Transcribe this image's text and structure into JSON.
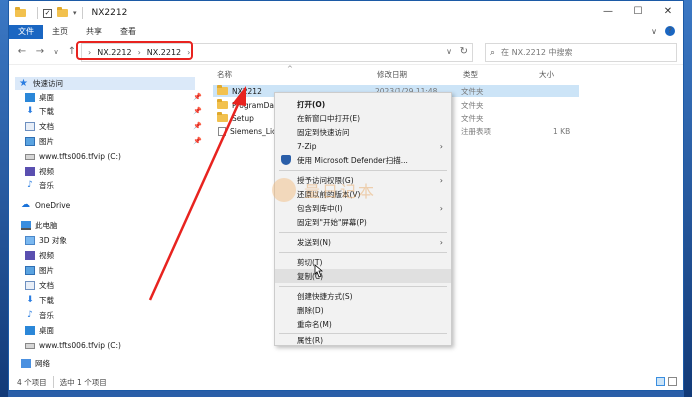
{
  "window": {
    "title": "NX2212",
    "quick_access_check": "✓",
    "controls": {
      "minimize": "—",
      "maximize": "☐",
      "close": "✕"
    }
  },
  "ribbon": {
    "tabs": [
      "文件",
      "主页",
      "共享",
      "查看"
    ],
    "expand": "∨",
    "help": "?"
  },
  "nav": {
    "back": "←",
    "forward": "→",
    "recent": "∨",
    "up": "↑",
    "address_crumbs": [
      "NX.2212",
      "NX.2212"
    ],
    "address_prefix": "›",
    "address_dropdown": "∨",
    "refresh": "↻",
    "search_placeholder": "在 NX.2212 中搜索",
    "search_icon": "search-icon",
    "highlight_color": "#e8231f"
  },
  "sidebar": {
    "pin": "📌",
    "quick_access": "快速访问",
    "quick_items": [
      {
        "label": "桌面",
        "icon": "desktop-icon",
        "pinned": true
      },
      {
        "label": "下载",
        "icon": "download-icon",
        "pinned": true
      },
      {
        "label": "文档",
        "icon": "document-icon",
        "pinned": true
      },
      {
        "label": "图片",
        "icon": "picture-icon",
        "pinned": true
      },
      {
        "label": "www.tfts006.tfvip (C:)",
        "icon": "drive-icon"
      },
      {
        "label": "视频",
        "icon": "video-icon"
      },
      {
        "label": "音乐",
        "icon": "music-icon"
      }
    ],
    "onedrive": "OneDrive",
    "this_pc": "此电脑",
    "pc_items": [
      {
        "label": "3D 对象",
        "icon": "3d-objects-icon"
      },
      {
        "label": "视频",
        "icon": "video-icon"
      },
      {
        "label": "图片",
        "icon": "picture-icon"
      },
      {
        "label": "文档",
        "icon": "document-icon"
      },
      {
        "label": "下载",
        "icon": "download-icon"
      },
      {
        "label": "音乐",
        "icon": "music-icon"
      },
      {
        "label": "桌面",
        "icon": "desktop-icon"
      },
      {
        "label": "www.tfts006.tfvip (C:)",
        "icon": "drive-icon"
      }
    ],
    "network": "网络"
  },
  "columns": {
    "name": "名称",
    "date": "修改日期",
    "type": "类型",
    "size": "大小",
    "sort_arrow": "^"
  },
  "files": [
    {
      "name": "NX2212",
      "date": "2023/1/29 11:48",
      "type": "文件夹",
      "size": "",
      "kind": "folder"
    },
    {
      "name": "ProgramData",
      "date": "",
      "type": "文件夹",
      "size": "",
      "kind": "folder"
    },
    {
      "name": "Setup",
      "date": "",
      "type": "文件夹",
      "size": "",
      "kind": "folder"
    },
    {
      "name": "Siemens_Licens",
      "date": "",
      "type": "注册表项",
      "size": "1 KB",
      "kind": "reg"
    }
  ],
  "context_menu": {
    "submenu_arrow": "›",
    "items": [
      {
        "label": "打开(O)",
        "bold": true
      },
      {
        "label": "在新窗口中打开(E)"
      },
      {
        "label": "固定到快速访问"
      },
      {
        "label": "7-Zip",
        "submenu": true
      },
      {
        "label": "使用 Microsoft Defender扫描...",
        "icon": "defender-shield-icon"
      },
      {
        "label": "授予访问权限(G)",
        "submenu": true
      },
      {
        "label": "还原以前的版本(V)"
      },
      {
        "label": "包含到库中(I)",
        "submenu": true
      },
      {
        "label": "固定到\"开始\"屏幕(P)"
      },
      {
        "label": "发送到(N)",
        "submenu": true
      },
      {
        "label": "剪切(T)"
      },
      {
        "label": "复制(C)",
        "hover": true
      },
      {
        "label": "创建快捷方式(S)"
      },
      {
        "label": "删除(D)"
      },
      {
        "label": "重命名(M)"
      },
      {
        "label": "属性(R)"
      }
    ]
  },
  "watermark": "量日记本",
  "status": {
    "count": "4 个项目",
    "selected": "选中 1 个项目"
  },
  "annotation": {
    "arrow_color": "#e8231f"
  }
}
